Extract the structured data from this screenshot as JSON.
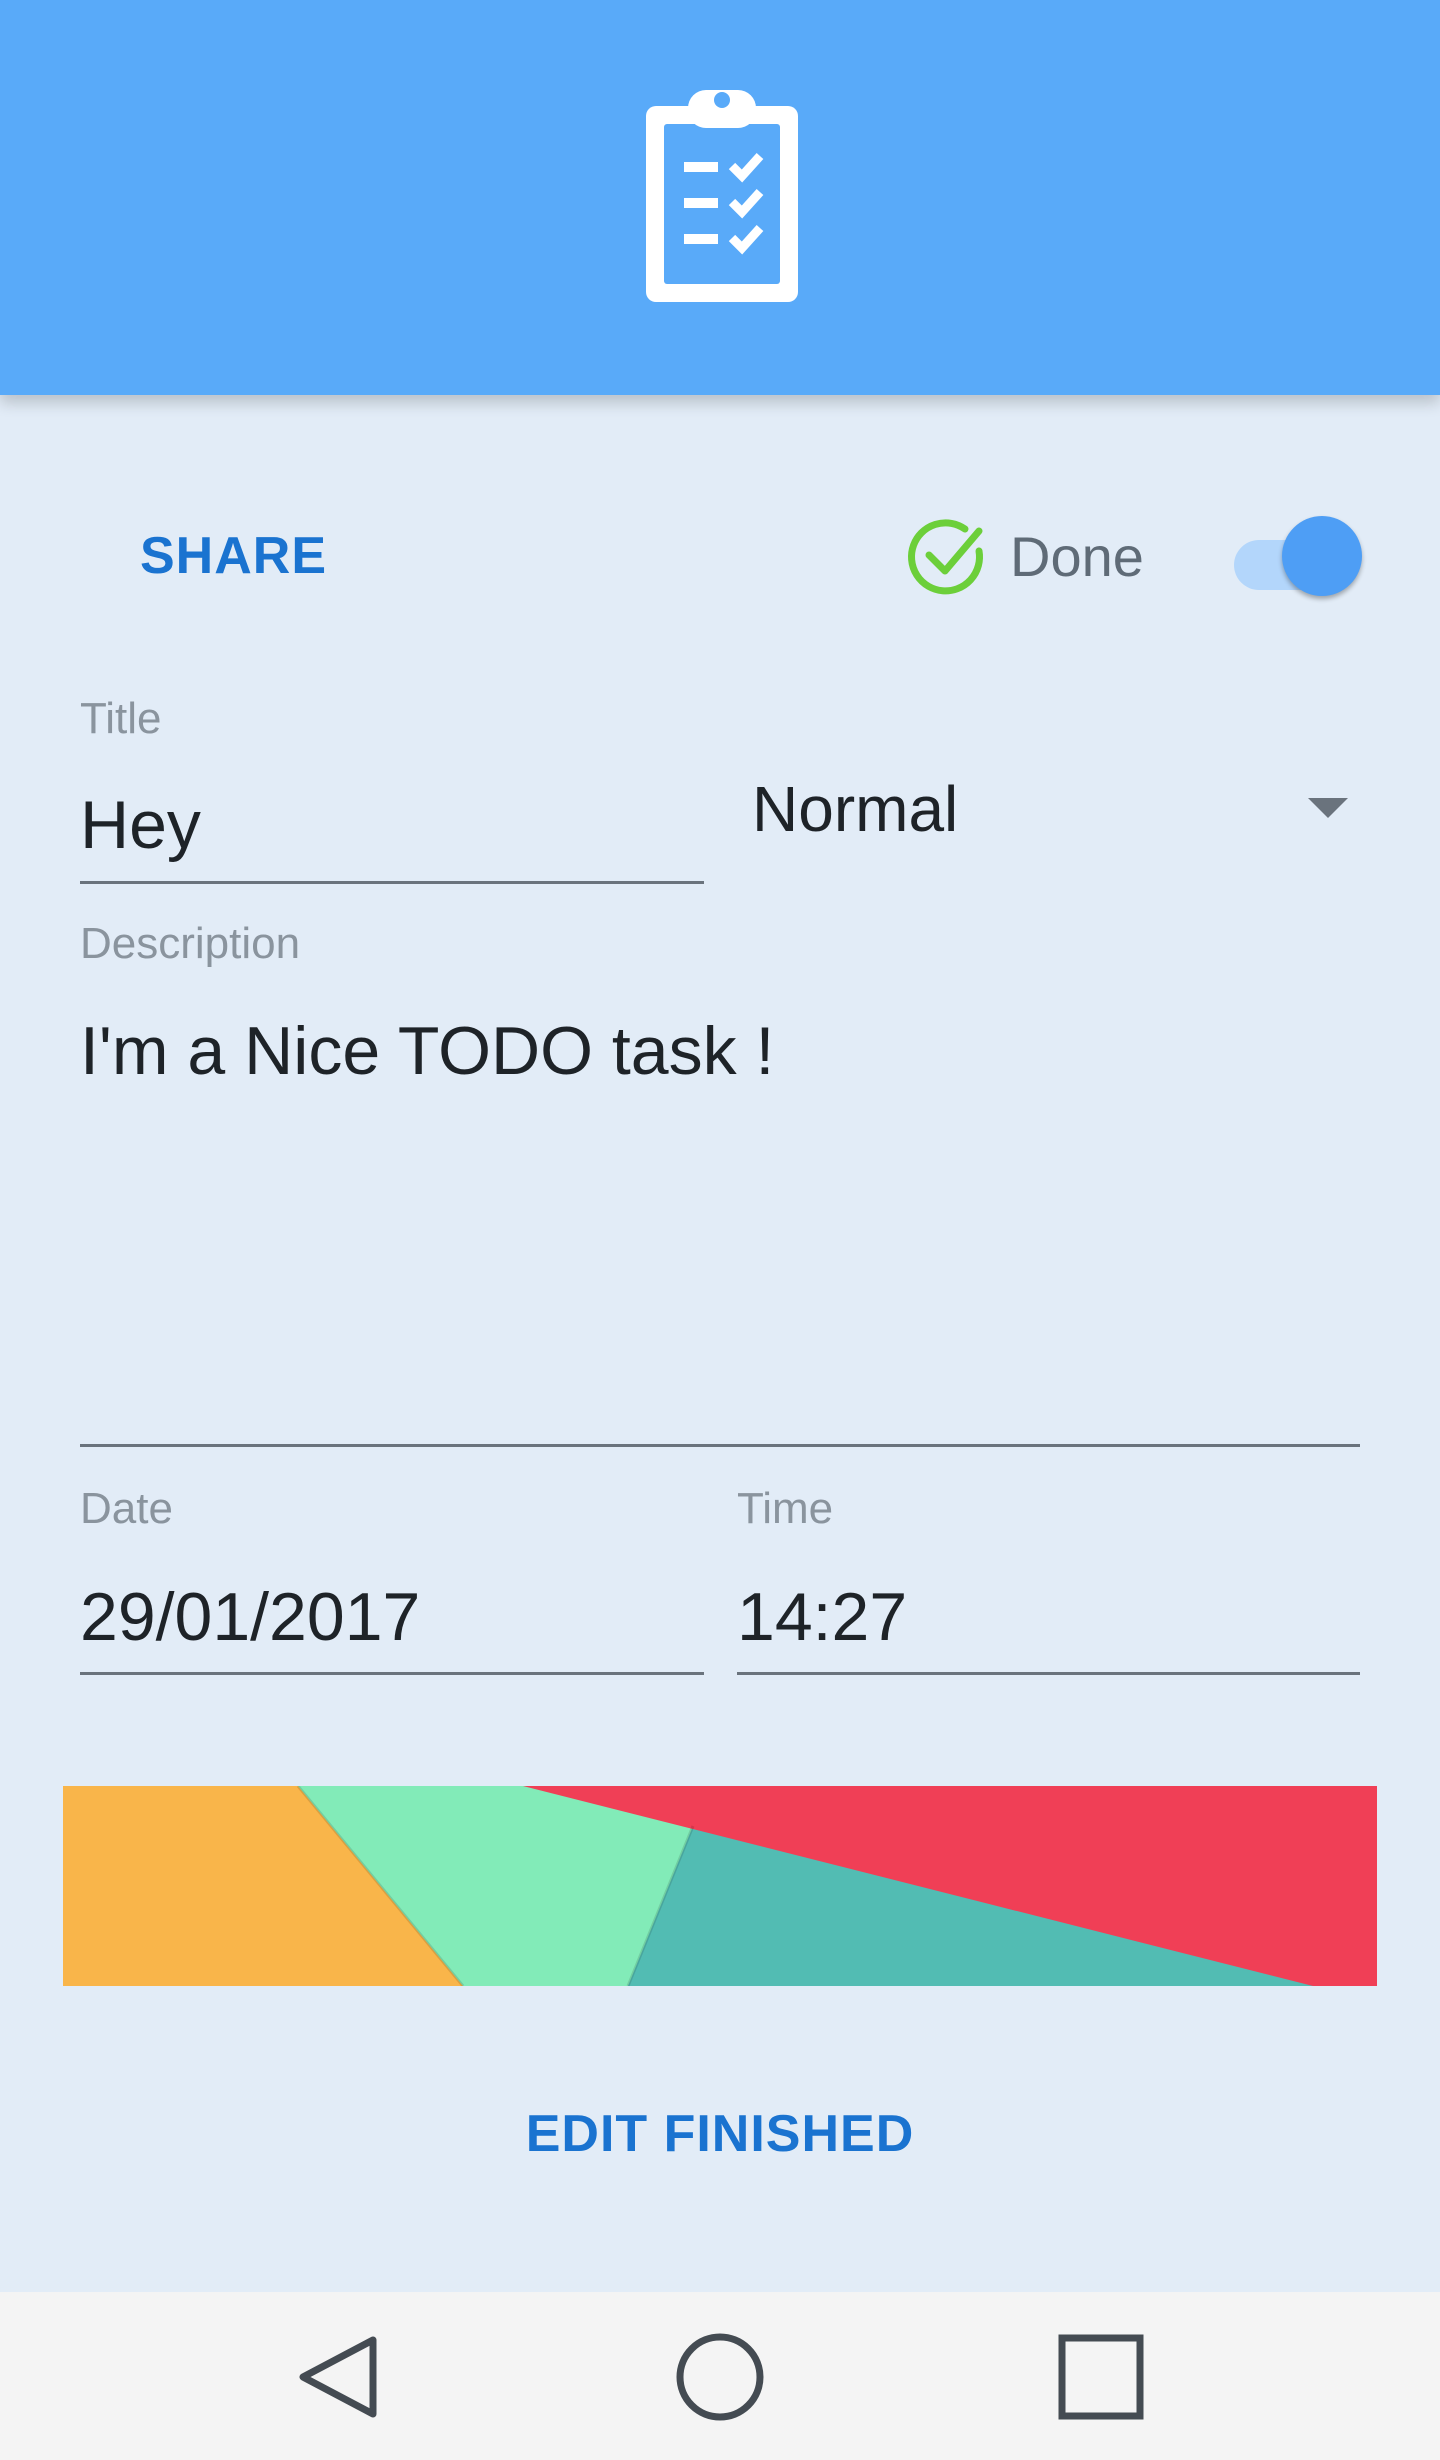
{
  "app_bar": {
    "icon": "clipboard-checklist-icon",
    "color": "#59aaf9"
  },
  "actions": {
    "share_label": "SHARE",
    "done_label": "Done",
    "done_icon": "check-circle-icon",
    "done_toggle_on": true
  },
  "form": {
    "title": {
      "label": "Title",
      "value": "Hey"
    },
    "priority": {
      "selected": "Normal"
    },
    "description": {
      "label": "Description",
      "value": "I'm a Nice TODO task !"
    },
    "date": {
      "label": "Date",
      "value": "29/01/2017"
    },
    "time": {
      "label": "Time",
      "value": "14:27"
    }
  },
  "footer": {
    "edit_finished_label": "EDIT FINISHED"
  },
  "nav_bar": {
    "buttons": [
      "back-icon",
      "home-icon",
      "recents-icon"
    ]
  },
  "colors": {
    "accent": "#1a73d0",
    "background": "#e2ecf7",
    "done_check": "#6ccf3a",
    "banner_orange": "#f9b54a",
    "banner_mint": "#82ebb8",
    "banner_teal": "#52bcb3",
    "banner_red": "#f03f56"
  }
}
